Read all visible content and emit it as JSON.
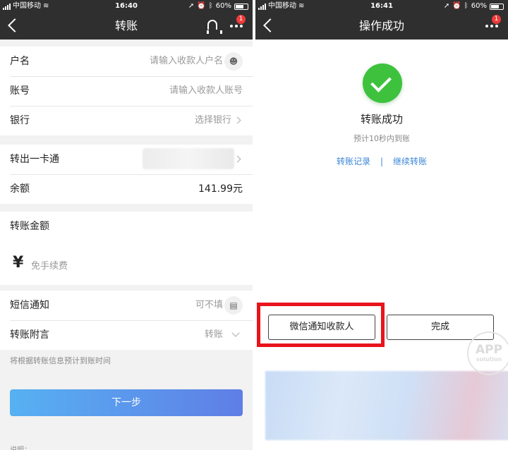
{
  "status_bar": {
    "carrier": "中国移动",
    "left_time": "16:40",
    "right_time": "16:41",
    "battery": "60%"
  },
  "left": {
    "nav": {
      "title": "转账",
      "badge": "1"
    },
    "payee": {
      "name_label": "户名",
      "name_placeholder": "请输入收款人户名",
      "account_label": "账号",
      "account_placeholder": "请输入收款人账号",
      "bank_label": "银行",
      "bank_placeholder": "选择银行"
    },
    "source": {
      "card_label": "转出一卡通",
      "balance_label": "余额",
      "balance_value": "141.99元"
    },
    "amount": {
      "label": "转账金额",
      "currency": "¥",
      "placeholder": "免手续费"
    },
    "extras": {
      "sms_label": "短信通知",
      "sms_value": "可不填",
      "memo_label": "转账附言",
      "memo_value": "转账"
    },
    "hint": "将根据转账信息预计到账时间",
    "next_label": "下一步",
    "note": "说明："
  },
  "right": {
    "nav": {
      "title": "操作成功",
      "badge": "1"
    },
    "success_title": "转账成功",
    "success_sub": "预计10秒内到账",
    "link_records": "转账记录",
    "link_separator": "|",
    "link_continue": "继续转账",
    "wechat_button": "微信通知收款人",
    "done_button": "完成",
    "watermark_main": "APP",
    "watermark_sub": "solution"
  },
  "colors": {
    "nav_bg": "#2f2f2f",
    "accent_blue": "#3a86d6",
    "success_green": "#3ec23e",
    "highlight_red": "#e8141c",
    "badge_red": "#ef3b3b"
  }
}
